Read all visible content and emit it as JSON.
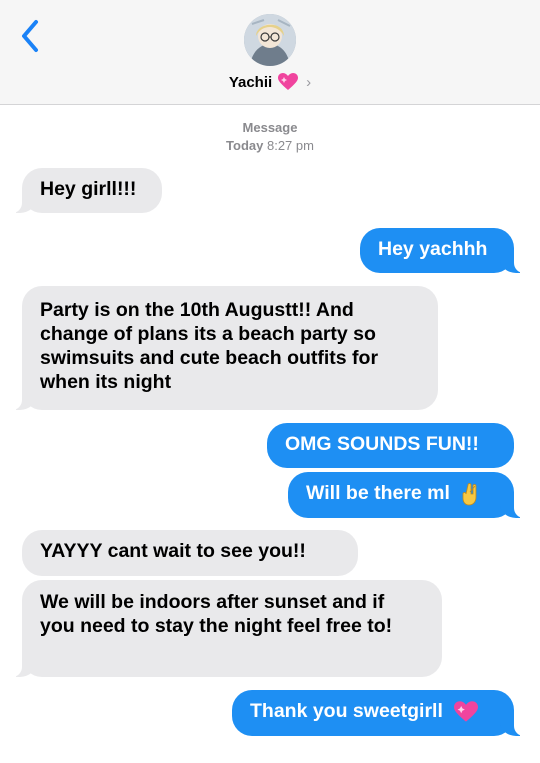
{
  "header": {
    "contact_name": "Yachii",
    "chevron": "›",
    "back_icon": "chevron-left-icon",
    "avatar": "contact-avatar",
    "name_emoji": "sparkling-heart-emoji"
  },
  "thread": {
    "service": "Message",
    "day": "Today",
    "time": "8:27 pm"
  },
  "messages": [
    {
      "from": "them",
      "text": "Hey girll!!!"
    },
    {
      "from": "me",
      "text": "Hey yachhh"
    },
    {
      "from": "them",
      "text": "Party is on the 10th Augustt!! And change of plans its a beach party so swimsuits and cute beach outfits for when its night"
    },
    {
      "from": "me",
      "text": "OMG SOUNDS FUN!!"
    },
    {
      "from": "me",
      "text": "Will be there ml",
      "emoji": "crossed-fingers-emoji"
    },
    {
      "from": "them",
      "text": "YAYYY cant wait to see you!!"
    },
    {
      "from": "them",
      "text": "We will be indoors after sunset and if you need to stay the night feel free to!"
    },
    {
      "from": "me",
      "text": "Thank you sweetgirll",
      "emoji": "sparkling-heart-emoji"
    }
  ],
  "colors": {
    "outgoing": "#1e8ff3",
    "incoming": "#e9e9eb",
    "header_bg": "#f6f6f6",
    "accent": "#1a82f7"
  }
}
